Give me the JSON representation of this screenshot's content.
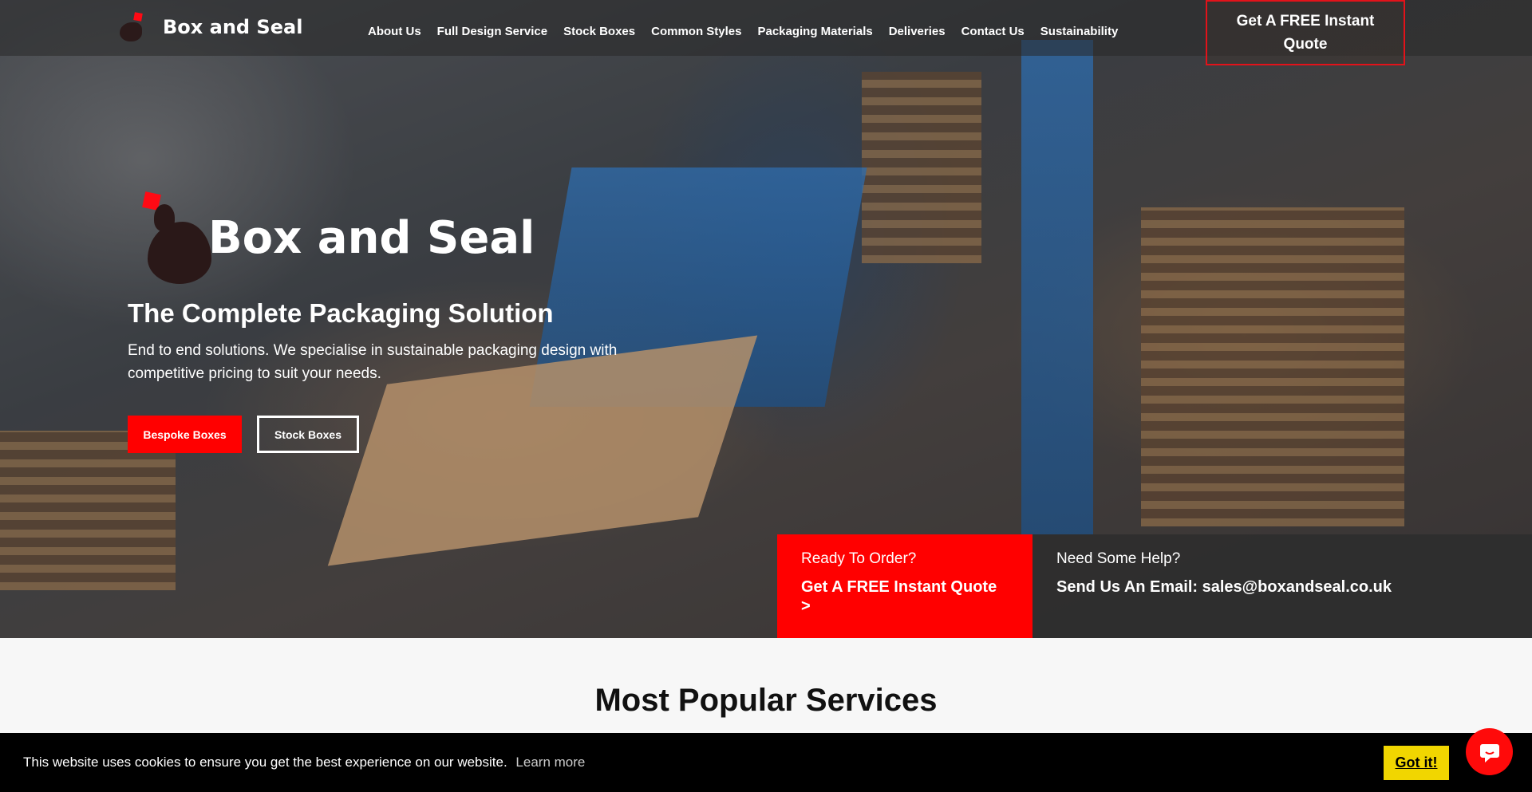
{
  "brand": {
    "name": "Box and Seal"
  },
  "nav": {
    "items": [
      "About Us",
      "Full Design Service",
      "Stock Boxes",
      "Common Styles",
      "Packaging Materials",
      "Deliveries",
      "Contact Us",
      "Sustainability"
    ],
    "quote_button": "Get A FREE Instant Quote"
  },
  "hero": {
    "logo_title": "Box and Seal",
    "tagline": "The Complete Packaging Solution",
    "subtext": "End to end solutions. We specialise in sustainable packaging design with competitive pricing to suit your needs.",
    "primary_button": "Bespoke Boxes",
    "secondary_button": "Stock Boxes"
  },
  "cta": {
    "order_small": "Ready To Order?",
    "order_big": "Get A FREE Instant Quote >",
    "help_small": "Need Some Help?",
    "help_big": "Send Us An Email: sales@boxandseal.co.uk"
  },
  "section": {
    "title": "Most Popular Services"
  },
  "cookie": {
    "message": "This website uses cookies to ensure you get the best experience on our website.",
    "learn_more": "Learn more",
    "accept": "Got it!"
  },
  "colors": {
    "accent": "#ff0000",
    "cookie_accept": "#f1d600"
  },
  "icons": {
    "chat": "chat-icon",
    "logo": "seal-logo-icon"
  }
}
